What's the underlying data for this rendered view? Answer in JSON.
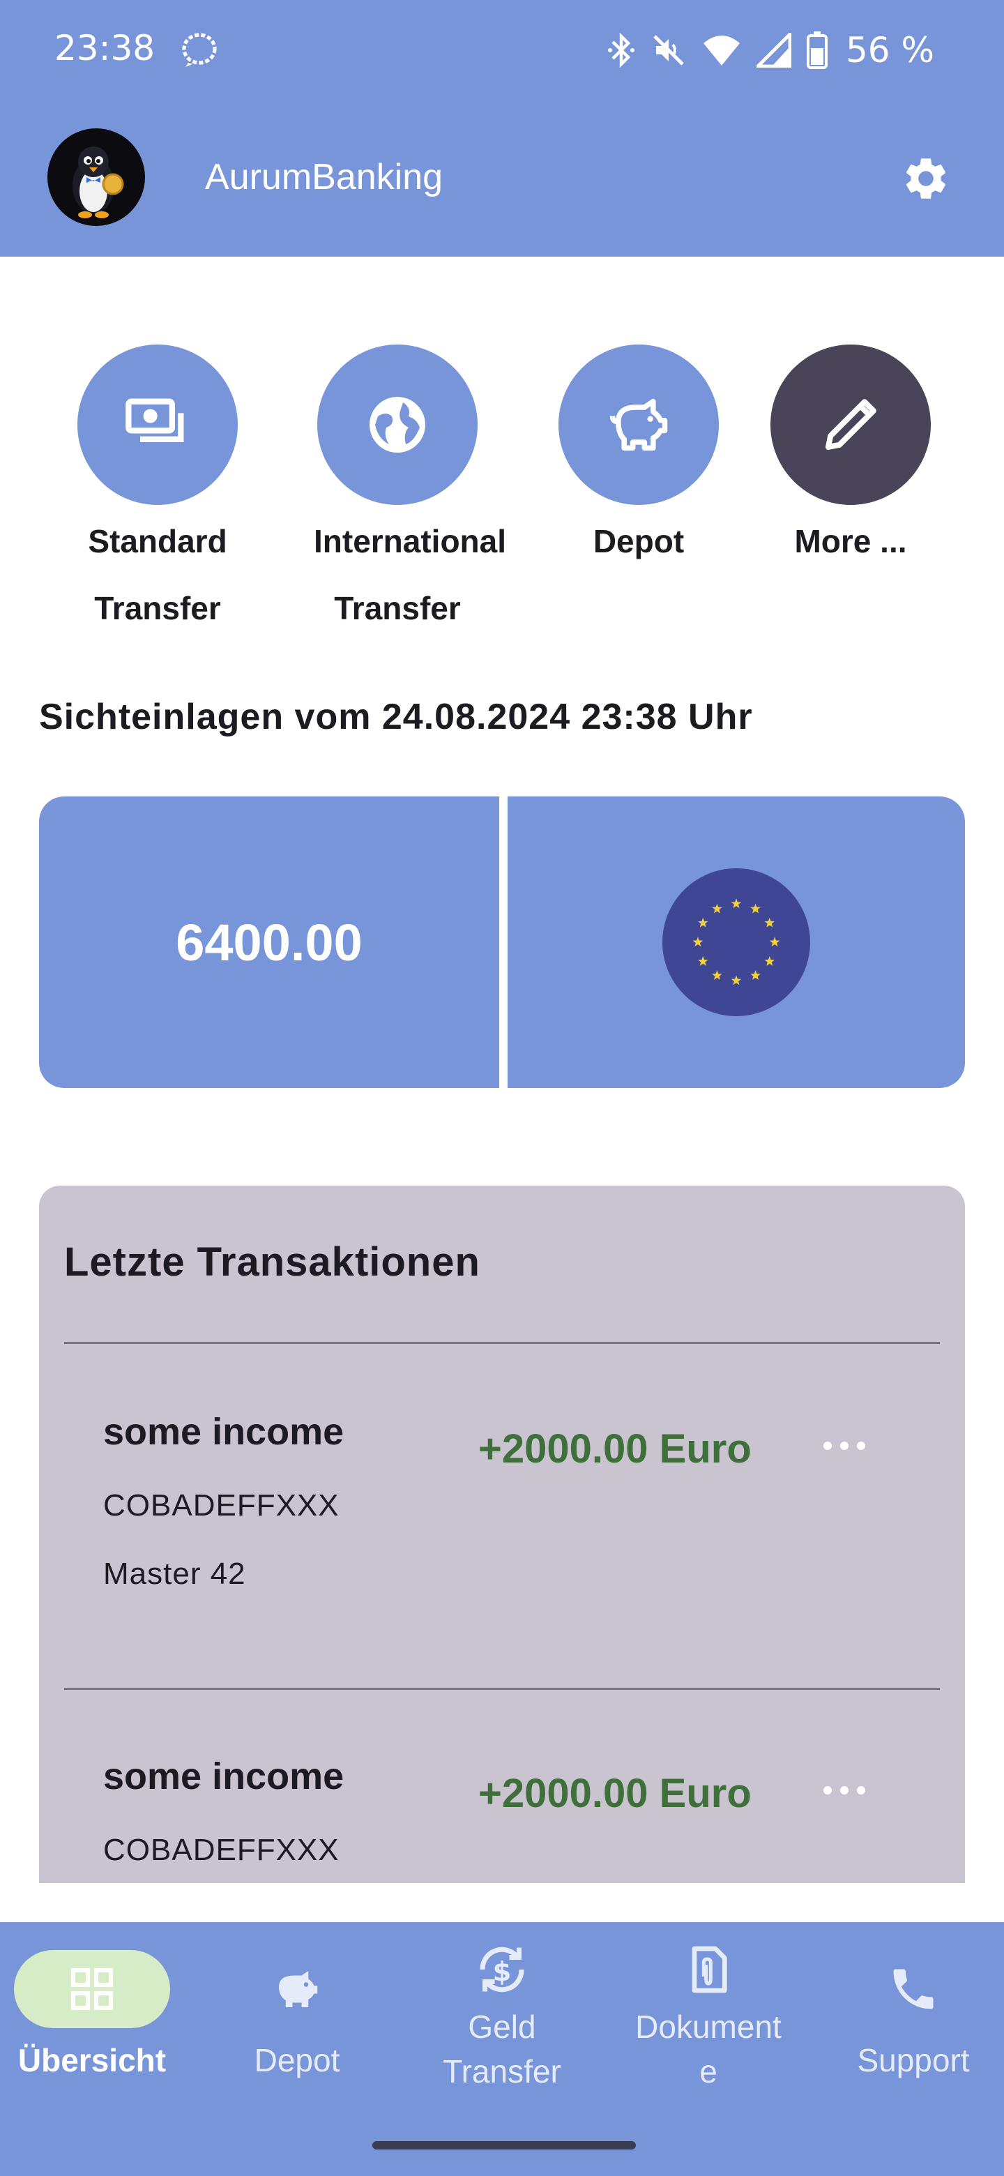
{
  "status_bar": {
    "time": "23:38",
    "battery_percent": "56 %",
    "icons": [
      "signal-app-icon",
      "bluetooth-icon",
      "mute-icon",
      "wifi-icon",
      "cell-signal-icon",
      "battery-icon"
    ]
  },
  "app_bar": {
    "title": "AurumBanking",
    "avatar_icon": "penguin-logo-icon",
    "settings_icon": "gear-icon"
  },
  "quick_actions": [
    {
      "line1": "Standard",
      "line2": "Transfer",
      "icon": "banknotes-icon"
    },
    {
      "line1": "International",
      "line2": "Transfer",
      "icon": "globe-icon"
    },
    {
      "line1": "Depot",
      "line2": "",
      "icon": "piggy-bank-icon"
    },
    {
      "line1": "More ...",
      "line2": "",
      "icon": "pencil-icon"
    }
  ],
  "balance": {
    "heading": "Sichteinlagen vom 24.08.2024 23:38 Uhr",
    "amount": "6400.00",
    "currency_icon": "eu-flag-icon"
  },
  "transactions": {
    "title": "Letzte Transaktionen",
    "items": [
      {
        "name": "some income",
        "bic": "COBADEFFXXX",
        "reference": "Master 42",
        "amount": "+2000.00 Euro"
      },
      {
        "name": "some income",
        "bic": "COBADEFFXXX",
        "reference": "",
        "amount": "+2000.00 Euro"
      }
    ]
  },
  "bottom_nav": [
    {
      "line1": "Übersicht",
      "line2": "",
      "icon": "grid-icon",
      "active": true
    },
    {
      "line1": "Depot",
      "line2": "",
      "icon": "piggy-bank-icon",
      "active": false
    },
    {
      "line1": "Geld",
      "line2": "Transfer",
      "icon": "currency-exchange-icon",
      "active": false
    },
    {
      "line1": "Dokument",
      "line2": "e",
      "icon": "document-attachment-icon",
      "active": false
    },
    {
      "line1": "Support",
      "line2": "",
      "icon": "phone-icon",
      "active": false
    }
  ],
  "colors": {
    "primary": "#7795d8",
    "dark_action": "#4a4458",
    "card_bg": "#cac4d0",
    "positive_amount": "#3f6f3a",
    "nav_active_pill": "#d6ecc7"
  }
}
